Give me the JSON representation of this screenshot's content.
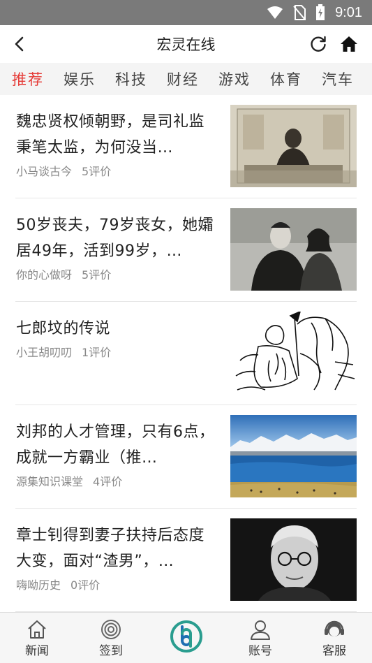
{
  "status_bar": {
    "time": "9:01",
    "icons": [
      "wifi-icon",
      "no-sim-icon",
      "battery-charging-icon"
    ]
  },
  "header": {
    "title": "宏灵在线",
    "back_icon": "chevron-left-icon",
    "refresh_icon": "refresh-icon",
    "home_icon": "home-icon"
  },
  "tabs": [
    {
      "label": "推荐",
      "active": true
    },
    {
      "label": "娱乐"
    },
    {
      "label": "科技"
    },
    {
      "label": "财经"
    },
    {
      "label": "游戏"
    },
    {
      "label": "体育"
    },
    {
      "label": "汽车"
    }
  ],
  "feed": [
    {
      "headline": "魏忠贤权倾朝野，是司礼监秉笔太监，为何没当…",
      "source": "小马谈古今",
      "comments": "5评价"
    },
    {
      "headline": "50岁丧夫，79岁丧女，她孀居49年，活到99岁，…",
      "source": "你的心做呀",
      "comments": "5评价"
    },
    {
      "headline": "七郎坟的传说",
      "source": "小王胡叨叨",
      "comments": "1评价"
    },
    {
      "headline": "刘邦的人才管理，只有6点，成就一方霸业（推…",
      "source": "源集知识课堂",
      "comments": "4评价"
    },
    {
      "headline": "章士钊得到妻子扶持后态度大变，面对“渣男”，…",
      "source": "嗨呦历史",
      "comments": "0评价"
    }
  ],
  "bottom_nav": [
    {
      "label": "新闻",
      "icon": "house-icon"
    },
    {
      "label": "签到",
      "icon": "target-icon"
    },
    {
      "label": "",
      "icon": "app-logo-icon"
    },
    {
      "label": "账号",
      "icon": "user-icon"
    },
    {
      "label": "客服",
      "icon": "headset-icon"
    }
  ],
  "colors": {
    "accent": "#e53935",
    "status_bar": "#7a7a7a",
    "logo_teal": "#2a9d8f"
  }
}
